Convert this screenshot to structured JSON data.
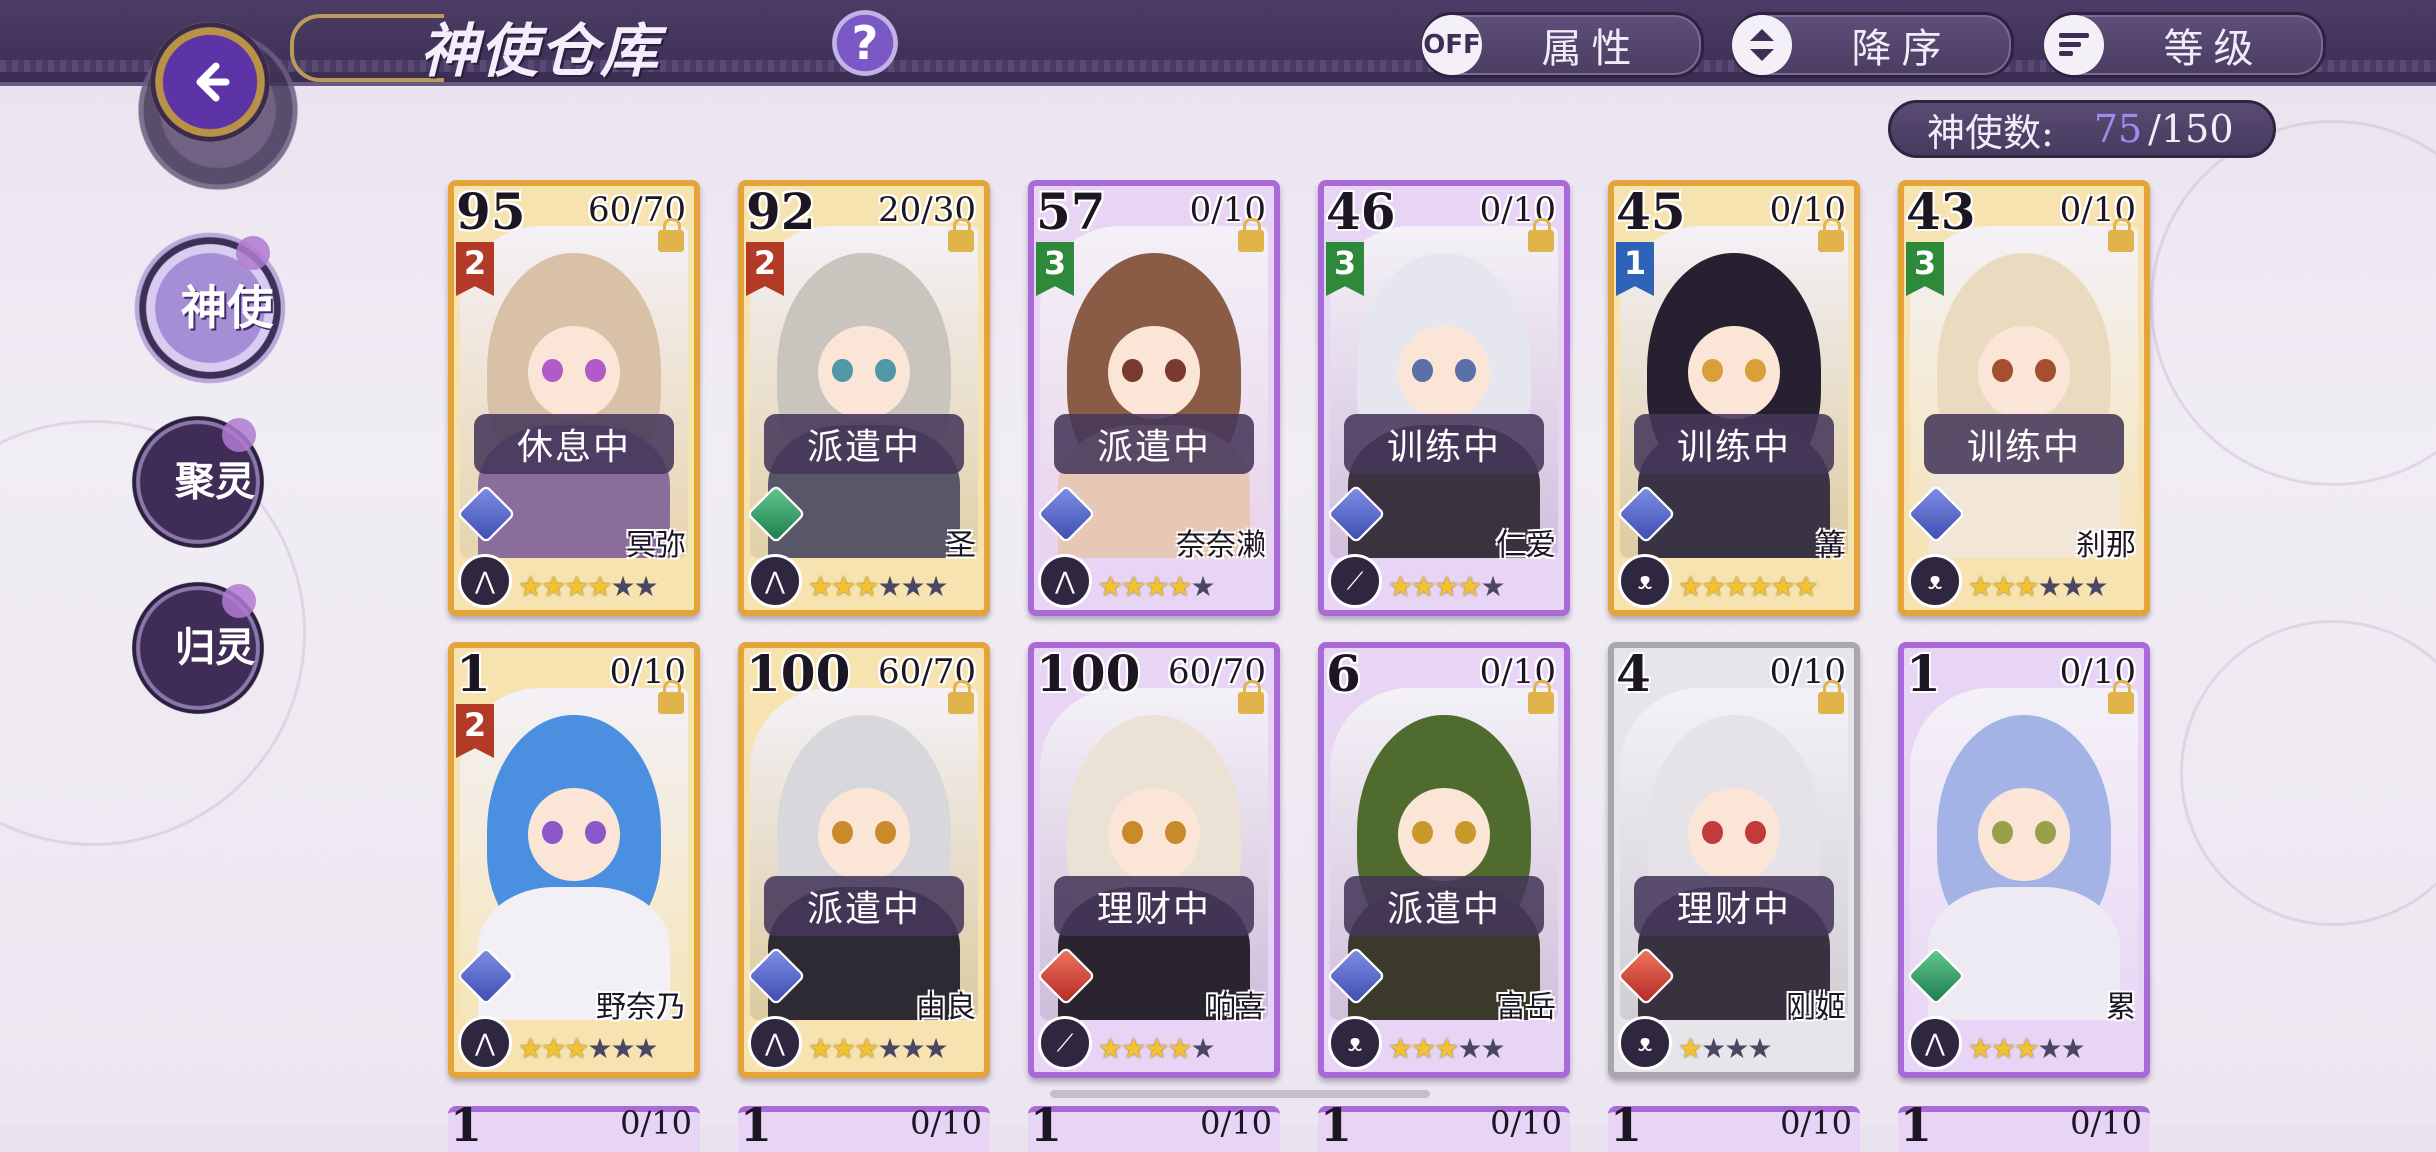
{
  "header": {
    "title": "神使仓库",
    "help_label": "?",
    "attribute_toggle": {
      "state": "OFF",
      "label": "属性"
    },
    "sort_order": {
      "label": "降序",
      "icon": "up-down-arrows-icon"
    },
    "sort_by": {
      "label": "等级",
      "icon": "sort-lines-icon"
    }
  },
  "counter": {
    "label": "神使数:",
    "current": "75",
    "max": "/150"
  },
  "side_nav": [
    {
      "label": "神使",
      "active": true
    },
    {
      "label": "聚灵",
      "active": false
    },
    {
      "label": "归灵",
      "active": false
    }
  ],
  "cards": [
    {
      "level": "95",
      "exp": "60/70",
      "rank": "2",
      "status": "休息中",
      "element": "water",
      "weapon": "dual-blade-icon",
      "name": "冥弥",
      "stars_gold": 4,
      "stars_dark": 2,
      "frame": "gold",
      "hair": "#d9c1a8",
      "eye": "#b25bc8",
      "body": "#8a6d9a"
    },
    {
      "level": "92",
      "exp": "20/30",
      "rank": "2",
      "status": "派遣中",
      "element": "wind",
      "weapon": "dual-blade-icon",
      "name": "圣",
      "stars_gold": 3,
      "stars_dark": 3,
      "frame": "gold",
      "hair": "#c9c4be",
      "eye": "#4e98a8",
      "body": "#595667"
    },
    {
      "level": "57",
      "exp": "0/10",
      "rank": "3",
      "status": "派遣中",
      "element": "water",
      "weapon": "dual-blade-icon",
      "name": "奈奈濑",
      "stars_gold": 4,
      "stars_dark": 1,
      "frame": "purple",
      "hair": "#8a5c45",
      "eye": "#7a3a30",
      "body": "#e7c7b5"
    },
    {
      "level": "46",
      "exp": "0/10",
      "rank": "3",
      "status": "训练中",
      "element": "water",
      "weapon": "sword-icon",
      "name": "仁爱",
      "stars_gold": 4,
      "stars_dark": 1,
      "frame": "purple",
      "hair": "#e6e6ee",
      "eye": "#5b6fa8",
      "body": "#3b3240"
    },
    {
      "level": "45",
      "exp": "0/10",
      "rank": "1",
      "status": "训练中",
      "element": "water",
      "weapon": "claw-icon",
      "name": "篝",
      "stars_gold": 6,
      "stars_dark": 0,
      "frame": "gold",
      "hair": "#262030",
      "eye": "#d9a03a",
      "body": "#3a3344"
    },
    {
      "level": "43",
      "exp": "0/10",
      "rank": "3",
      "status": "训练中",
      "element": "water",
      "weapon": "claw-icon",
      "name": "刹那",
      "stars_gold": 3,
      "stars_dark": 3,
      "frame": "gold",
      "hair": "#eadbc0",
      "eye": "#a4502e",
      "body": "#f1e6d8"
    },
    {
      "level": "1",
      "exp": "0/10",
      "rank": "2",
      "status": "",
      "element": "water",
      "weapon": "dual-blade-icon",
      "name": "野奈乃",
      "stars_gold": 3,
      "stars_dark": 3,
      "frame": "gold",
      "hair": "#4a8fe0",
      "eye": "#8a58c8",
      "body": "#f2f0f4"
    },
    {
      "level": "100",
      "exp": "60/70",
      "rank": "",
      "status": "派遣中",
      "element": "water",
      "weapon": "dual-blade-icon",
      "name": "由良",
      "stars_gold": 3,
      "stars_dark": 3,
      "frame": "gold",
      "hair": "#d8d8dc",
      "eye": "#c98a2a",
      "body": "#2e2a33"
    },
    {
      "level": "100",
      "exp": "60/70",
      "rank": "",
      "status": "理财中",
      "element": "fire",
      "weapon": "sword-icon",
      "name": "响喜",
      "stars_gold": 4,
      "stars_dark": 1,
      "frame": "purple",
      "hair": "#ece1d5",
      "eye": "#c98a2a",
      "body": "#2a2430"
    },
    {
      "level": "6",
      "exp": "0/10",
      "rank": "",
      "status": "派遣中",
      "element": "water",
      "weapon": "claw-icon",
      "name": "富岳",
      "stars_gold": 3,
      "stars_dark": 2,
      "frame": "purple",
      "hair": "#4f6b2e",
      "eye": "#c99a2a",
      "body": "#3b3a2a"
    },
    {
      "level": "4",
      "exp": "0/10",
      "rank": "",
      "status": "理财中",
      "element": "fire",
      "weapon": "claw-icon",
      "name": "刚姬",
      "stars_gold": 1,
      "stars_dark": 3,
      "frame": "silver",
      "hair": "#e6e3e8",
      "eye": "#c23a3a",
      "body": "#3a3140"
    },
    {
      "level": "1",
      "exp": "0/10",
      "rank": "",
      "status": "",
      "element": "wind",
      "weapon": "dual-blade-icon",
      "name": "累",
      "stars_gold": 3,
      "stars_dark": 2,
      "frame": "purple",
      "hair": "#a4b3e6",
      "eye": "#9aa04a",
      "body": "#eeeaf3"
    }
  ],
  "partial_row": [
    {
      "level": "1",
      "exp": "0/10"
    },
    {
      "level": "1",
      "exp": "0/10"
    },
    {
      "level": "1",
      "exp": "0/10"
    },
    {
      "level": "1",
      "exp": "0/10"
    },
    {
      "level": "1",
      "exp": "0/10"
    },
    {
      "level": "1",
      "exp": "0/10"
    }
  ]
}
